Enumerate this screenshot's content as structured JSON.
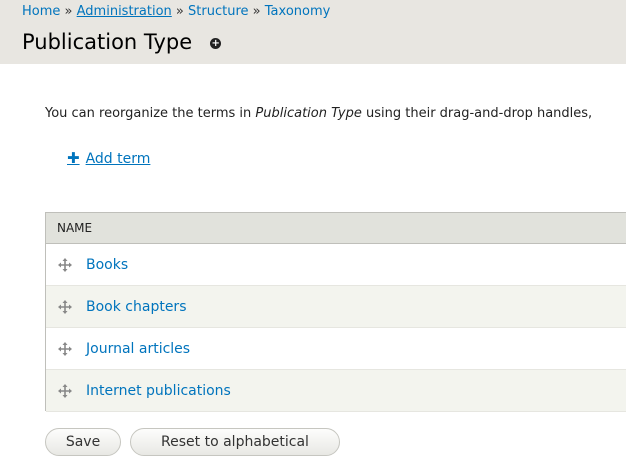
{
  "breadcrumb": {
    "home": "Home",
    "administration": "Administration",
    "structure": "Structure",
    "taxonomy": "Taxonomy",
    "separator": "»"
  },
  "page": {
    "title": "Publication Type",
    "shortcut_symbol": "+"
  },
  "help": {
    "prefix": "You can reorganize the terms in ",
    "vocabulary": "Publication Type",
    "suffix": " using their drag-and-drop handles,"
  },
  "actions": {
    "add_term": "Add term",
    "add_term_icon": "plus-icon"
  },
  "table": {
    "header_name": "NAME",
    "rows": [
      {
        "label": "Books"
      },
      {
        "label": "Book chapters"
      },
      {
        "label": "Journal articles"
      },
      {
        "label": "Internet publications"
      }
    ]
  },
  "buttons": {
    "save": "Save",
    "reset": "Reset to alphabetical"
  },
  "colors": {
    "link": "#0074bd",
    "header_bg": "#e8e6e1",
    "table_header_bg": "#e1e2dc",
    "row_even_bg": "#f3f4ee"
  }
}
